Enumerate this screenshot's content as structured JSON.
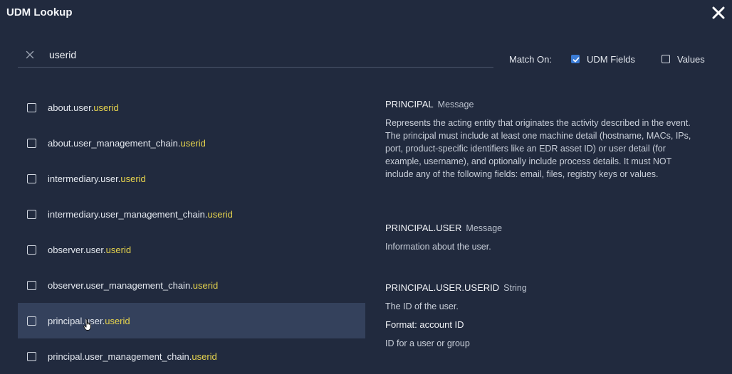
{
  "window": {
    "title": "UDM Lookup",
    "close_icon": "close-icon"
  },
  "search": {
    "value": "userid",
    "clear_icon": "x-icon"
  },
  "match_on": {
    "label": "Match On:",
    "options": [
      {
        "label": "UDM Fields",
        "checked": true
      },
      {
        "label": "Values",
        "checked": false
      }
    ]
  },
  "results": [
    {
      "prefix": "about.user.",
      "match": "userid",
      "checked": false
    },
    {
      "prefix": "about.user_management_chain.",
      "match": "userid",
      "checked": false
    },
    {
      "prefix": "intermediary.user.",
      "match": "userid",
      "checked": false
    },
    {
      "prefix": "intermediary.user_management_chain.",
      "match": "userid",
      "checked": false
    },
    {
      "prefix": "observer.user.",
      "match": "userid",
      "checked": false
    },
    {
      "prefix": "observer.user_management_chain.",
      "match": "userid",
      "checked": false
    },
    {
      "prefix": "principal.user.",
      "match": "userid",
      "checked": false,
      "hovered": true
    },
    {
      "prefix": "principal.user_management_chain.",
      "match": "userid",
      "checked": false
    }
  ],
  "details": [
    {
      "name": "PRINCIPAL",
      "type": "Message",
      "description": "Represents the acting entity that originates the activity described in the event. The principal must include at least one machine detail (hostname, MACs, IPs, port, product-specific identifiers like an EDR asset ID) or user detail (for example, username), and optionally include process details. It must NOT include any of the following fields: email, files, registry keys or values."
    },
    {
      "name": "PRINCIPAL.USER",
      "type": "Message",
      "description": "Information about the user."
    },
    {
      "name": "PRINCIPAL.USER.USERID",
      "type": "String",
      "description": "The ID of the user.",
      "format_label": "Format: account ID",
      "format_description": "ID for a user or group"
    }
  ]
}
